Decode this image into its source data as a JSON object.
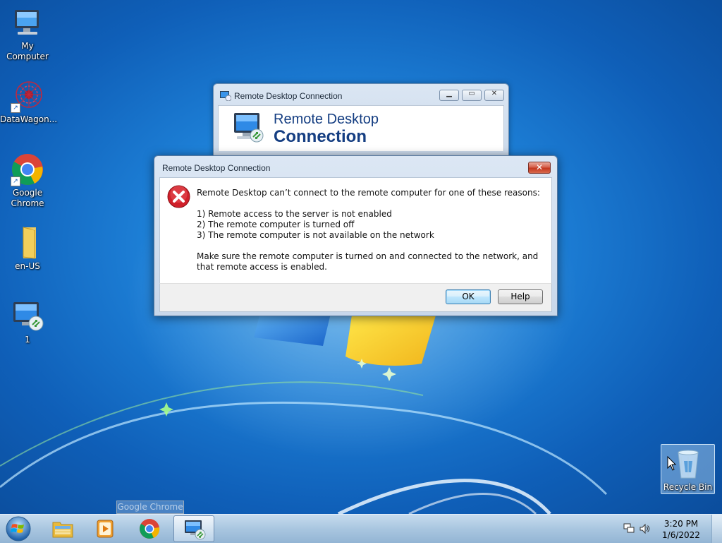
{
  "desktop": {
    "icons": [
      {
        "label": "My Computer",
        "icon": "computer-icon"
      },
      {
        "label": "DataWagon...",
        "icon": "datawagon-icon"
      },
      {
        "label": "Google Chrome",
        "icon": "chrome-icon"
      },
      {
        "label": "en-US",
        "icon": "folder-icon"
      },
      {
        "label": "1",
        "icon": "remote-desktop-icon"
      },
      {
        "label": "Recycle Bin",
        "icon": "recycle-bin-icon"
      }
    ]
  },
  "rdc_window": {
    "title": "Remote Desktop Connection",
    "banner_line1": "Remote Desktop",
    "banner_line2": "Connection",
    "buttons": {
      "minimize": "minimize",
      "restore": "restore",
      "close": "close"
    }
  },
  "error_dialog": {
    "title": "Remote Desktop Connection",
    "message_intro": "Remote Desktop can’t connect to the remote computer for one of these reasons:",
    "reasons": [
      "1) Remote access to the server is not enabled",
      "2) The remote computer is turned off",
      "3) The remote computer is not available on the network"
    ],
    "message_body": "Make sure the remote computer is turned on and connected to the network, and that remote access is enabled.",
    "ok_label": "OK",
    "help_label": "Help",
    "close_glyph": "✕"
  },
  "tooltip": {
    "text": "Google Chrome"
  },
  "taskbar": {
    "items": [
      {
        "name": "start",
        "icon": "windows-orb-icon"
      },
      {
        "name": "explorer",
        "icon": "folder-icon"
      },
      {
        "name": "media-player",
        "icon": "media-player-icon"
      },
      {
        "name": "chrome",
        "icon": "chrome-icon"
      },
      {
        "name": "remote-desktop",
        "icon": "remote-desktop-icon",
        "active": true
      }
    ],
    "clock": {
      "time": "3:20 PM",
      "date": "1/6/2022"
    }
  },
  "colors": {
    "desktop_blue": "#1d7fd6",
    "banner_text": "#153e82",
    "close_red": "#c4381f",
    "error_red": "#d0202a"
  }
}
